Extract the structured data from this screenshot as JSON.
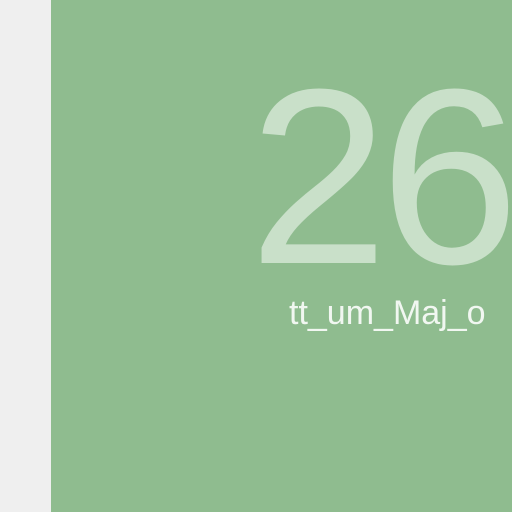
{
  "screen": {
    "left_rail_color": "#efefef",
    "tile_color": "#8fbc8f",
    "date_number": "26",
    "date_label": "tt_um_Maj_o"
  }
}
